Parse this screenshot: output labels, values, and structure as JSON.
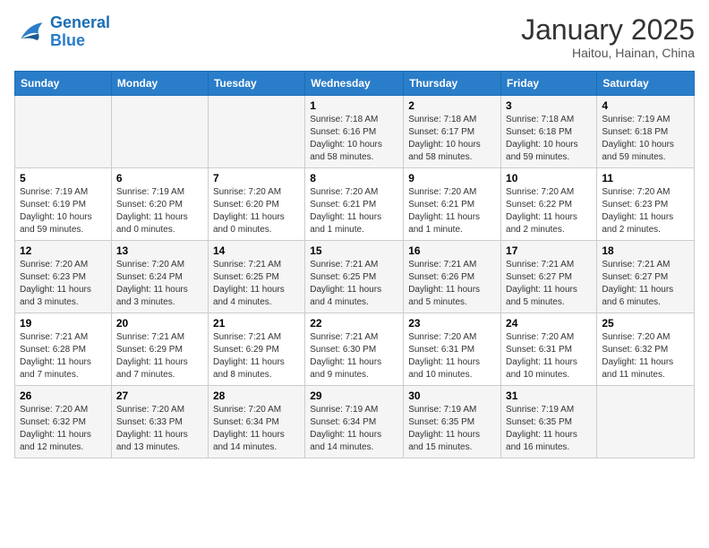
{
  "header": {
    "logo_general": "General",
    "logo_blue": "Blue",
    "month_year": "January 2025",
    "location": "Haitou, Hainan, China"
  },
  "weekdays": [
    "Sunday",
    "Monday",
    "Tuesday",
    "Wednesday",
    "Thursday",
    "Friday",
    "Saturday"
  ],
  "weeks": [
    [
      {
        "day": "",
        "sunrise": "",
        "sunset": "",
        "daylight": ""
      },
      {
        "day": "",
        "sunrise": "",
        "sunset": "",
        "daylight": ""
      },
      {
        "day": "",
        "sunrise": "",
        "sunset": "",
        "daylight": ""
      },
      {
        "day": "1",
        "sunrise": "Sunrise: 7:18 AM",
        "sunset": "Sunset: 6:16 PM",
        "daylight": "Daylight: 10 hours and 58 minutes."
      },
      {
        "day": "2",
        "sunrise": "Sunrise: 7:18 AM",
        "sunset": "Sunset: 6:17 PM",
        "daylight": "Daylight: 10 hours and 58 minutes."
      },
      {
        "day": "3",
        "sunrise": "Sunrise: 7:18 AM",
        "sunset": "Sunset: 6:18 PM",
        "daylight": "Daylight: 10 hours and 59 minutes."
      },
      {
        "day": "4",
        "sunrise": "Sunrise: 7:19 AM",
        "sunset": "Sunset: 6:18 PM",
        "daylight": "Daylight: 10 hours and 59 minutes."
      }
    ],
    [
      {
        "day": "5",
        "sunrise": "Sunrise: 7:19 AM",
        "sunset": "Sunset: 6:19 PM",
        "daylight": "Daylight: 10 hours and 59 minutes."
      },
      {
        "day": "6",
        "sunrise": "Sunrise: 7:19 AM",
        "sunset": "Sunset: 6:20 PM",
        "daylight": "Daylight: 11 hours and 0 minutes."
      },
      {
        "day": "7",
        "sunrise": "Sunrise: 7:20 AM",
        "sunset": "Sunset: 6:20 PM",
        "daylight": "Daylight: 11 hours and 0 minutes."
      },
      {
        "day": "8",
        "sunrise": "Sunrise: 7:20 AM",
        "sunset": "Sunset: 6:21 PM",
        "daylight": "Daylight: 11 hours and 1 minute."
      },
      {
        "day": "9",
        "sunrise": "Sunrise: 7:20 AM",
        "sunset": "Sunset: 6:21 PM",
        "daylight": "Daylight: 11 hours and 1 minute."
      },
      {
        "day": "10",
        "sunrise": "Sunrise: 7:20 AM",
        "sunset": "Sunset: 6:22 PM",
        "daylight": "Daylight: 11 hours and 2 minutes."
      },
      {
        "day": "11",
        "sunrise": "Sunrise: 7:20 AM",
        "sunset": "Sunset: 6:23 PM",
        "daylight": "Daylight: 11 hours and 2 minutes."
      }
    ],
    [
      {
        "day": "12",
        "sunrise": "Sunrise: 7:20 AM",
        "sunset": "Sunset: 6:23 PM",
        "daylight": "Daylight: 11 hours and 3 minutes."
      },
      {
        "day": "13",
        "sunrise": "Sunrise: 7:20 AM",
        "sunset": "Sunset: 6:24 PM",
        "daylight": "Daylight: 11 hours and 3 minutes."
      },
      {
        "day": "14",
        "sunrise": "Sunrise: 7:21 AM",
        "sunset": "Sunset: 6:25 PM",
        "daylight": "Daylight: 11 hours and 4 minutes."
      },
      {
        "day": "15",
        "sunrise": "Sunrise: 7:21 AM",
        "sunset": "Sunset: 6:25 PM",
        "daylight": "Daylight: 11 hours and 4 minutes."
      },
      {
        "day": "16",
        "sunrise": "Sunrise: 7:21 AM",
        "sunset": "Sunset: 6:26 PM",
        "daylight": "Daylight: 11 hours and 5 minutes."
      },
      {
        "day": "17",
        "sunrise": "Sunrise: 7:21 AM",
        "sunset": "Sunset: 6:27 PM",
        "daylight": "Daylight: 11 hours and 5 minutes."
      },
      {
        "day": "18",
        "sunrise": "Sunrise: 7:21 AM",
        "sunset": "Sunset: 6:27 PM",
        "daylight": "Daylight: 11 hours and 6 minutes."
      }
    ],
    [
      {
        "day": "19",
        "sunrise": "Sunrise: 7:21 AM",
        "sunset": "Sunset: 6:28 PM",
        "daylight": "Daylight: 11 hours and 7 minutes."
      },
      {
        "day": "20",
        "sunrise": "Sunrise: 7:21 AM",
        "sunset": "Sunset: 6:29 PM",
        "daylight": "Daylight: 11 hours and 7 minutes."
      },
      {
        "day": "21",
        "sunrise": "Sunrise: 7:21 AM",
        "sunset": "Sunset: 6:29 PM",
        "daylight": "Daylight: 11 hours and 8 minutes."
      },
      {
        "day": "22",
        "sunrise": "Sunrise: 7:21 AM",
        "sunset": "Sunset: 6:30 PM",
        "daylight": "Daylight: 11 hours and 9 minutes."
      },
      {
        "day": "23",
        "sunrise": "Sunrise: 7:20 AM",
        "sunset": "Sunset: 6:31 PM",
        "daylight": "Daylight: 11 hours and 10 minutes."
      },
      {
        "day": "24",
        "sunrise": "Sunrise: 7:20 AM",
        "sunset": "Sunset: 6:31 PM",
        "daylight": "Daylight: 11 hours and 10 minutes."
      },
      {
        "day": "25",
        "sunrise": "Sunrise: 7:20 AM",
        "sunset": "Sunset: 6:32 PM",
        "daylight": "Daylight: 11 hours and 11 minutes."
      }
    ],
    [
      {
        "day": "26",
        "sunrise": "Sunrise: 7:20 AM",
        "sunset": "Sunset: 6:32 PM",
        "daylight": "Daylight: 11 hours and 12 minutes."
      },
      {
        "day": "27",
        "sunrise": "Sunrise: 7:20 AM",
        "sunset": "Sunset: 6:33 PM",
        "daylight": "Daylight: 11 hours and 13 minutes."
      },
      {
        "day": "28",
        "sunrise": "Sunrise: 7:20 AM",
        "sunset": "Sunset: 6:34 PM",
        "daylight": "Daylight: 11 hours and 14 minutes."
      },
      {
        "day": "29",
        "sunrise": "Sunrise: 7:19 AM",
        "sunset": "Sunset: 6:34 PM",
        "daylight": "Daylight: 11 hours and 14 minutes."
      },
      {
        "day": "30",
        "sunrise": "Sunrise: 7:19 AM",
        "sunset": "Sunset: 6:35 PM",
        "daylight": "Daylight: 11 hours and 15 minutes."
      },
      {
        "day": "31",
        "sunrise": "Sunrise: 7:19 AM",
        "sunset": "Sunset: 6:35 PM",
        "daylight": "Daylight: 11 hours and 16 minutes."
      },
      {
        "day": "",
        "sunrise": "",
        "sunset": "",
        "daylight": ""
      }
    ]
  ]
}
